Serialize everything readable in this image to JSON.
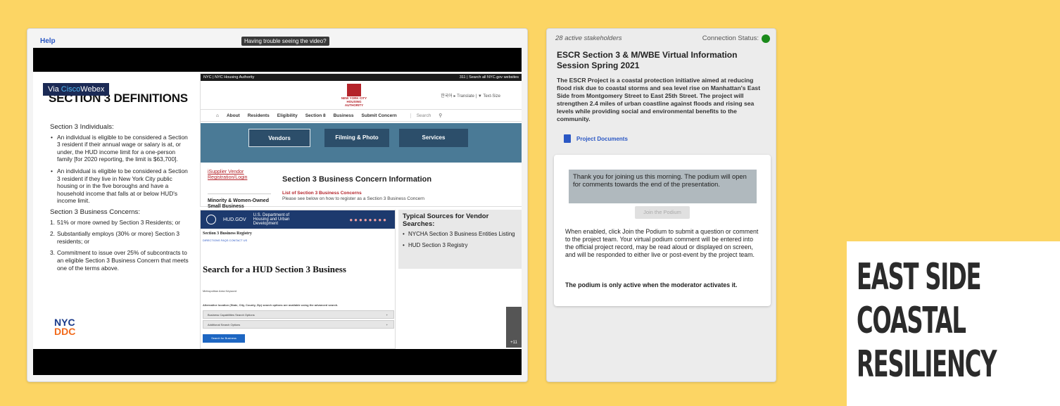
{
  "left_panel": {
    "help": "Help",
    "trouble": "Having trouble seeing the video?"
  },
  "webex": {
    "prefix": "Via ",
    "brand": "Cisco",
    "suffix": "Webex"
  },
  "slide": {
    "title": "SECTION 3 DEFINITIONS",
    "individuals_heading": "Section 3 Individuals:",
    "individuals": [
      "An individual is eligible to be considered a Section 3 resident if their annual wage or salary is at, or under, the HUD income limit for a one-person family [for 2020 reporting, the limit is $63,700].",
      "An individual is eligible to be considered a Section 3 resident if they live in New York City public housing or in the five boroughs and have a household income that falls at or below HUD's income limit."
    ],
    "concerns_heading": "Section 3 Business Concerns:",
    "concerns": [
      {
        "num": "1.",
        "text": "51% or more owned by Section 3 Residents; or"
      },
      {
        "num": "2.",
        "text": "Substantially employs (30% or more) Section 3 residents; or"
      },
      {
        "num": "3.",
        "text": "Commitment to issue over 25% of subcontracts to an eligible Section 3 Business Concern that meets one of the terms above."
      }
    ],
    "logo": {
      "line1": "NYC",
      "line2": "DDC"
    }
  },
  "nycha": {
    "bar_left": "NYC | NYC Housing Authority",
    "bar_right": "311 | Search all NYC.gov websites",
    "logo_text": "NEW YORK CITY HOUSING AUTHORITY",
    "lang": "한국어 ▸ Translate | ▼   Text-Size",
    "nav": [
      "About",
      "Residents",
      "Eligibility",
      "Section 8",
      "Business",
      "Submit Concern"
    ],
    "search": "Search",
    "buttons": [
      "Vendors",
      "Filming & Photo",
      "Services"
    ],
    "isupplier": "iSupplier Vendor Registration/Login",
    "mwob": "Minority & Women-Owned Small Business",
    "bci_title": "Section 3 Business Concern Information",
    "list_link": "List of Section 3 Business Concerns",
    "please": "Please see below on how to register as a Section 3 Business Concern"
  },
  "hud": {
    "gov": "HUD.GOV",
    "dept": "U.S. Department of Housing and Urban Development",
    "registry": "Section 3 Business Registry",
    "links": "DIRECTIONS   FAQS   CONTACT US",
    "search_title": "Search for a HUD Section 3 Business",
    "metro": "Metropolitan Area                                   Keyword",
    "alt": "Alternative location (State, City, County, Zip) search options are available using the advanced search.",
    "row1": "Business Capabilities Search Options",
    "row2": "Additional Search Options",
    "plus": "+",
    "button": "Search for Business"
  },
  "typical": {
    "heading": "Typical Sources for Vendor Searches:",
    "items": [
      "NYCHA Section 3 Business Entities Listing",
      "HUD Section 3 Registry"
    ]
  },
  "plus_count": "+11",
  "right_panel": {
    "stakeholders": "28 active stakeholders",
    "connection": "Connection Status:",
    "title": "ESCR Section 3 & M/WBE Virtual Information Session Spring 2021",
    "description": "The ESCR Project is a coastal protection initiative aimed at reducing flood risk due to coastal storms and sea level rise on Manhattan's East Side from Montgomery Street to East 25th Street. The project will strengthen 2.4 miles of urban coastline against floods and rising sea levels while providing social and environmental benefits to the community.",
    "documents": "Project Documents",
    "notice": "Thank you for joining us this morning. The podium will open for comments towards the end of the presentation.",
    "join": "Join the Podium",
    "enabled": "When enabled, click Join the Podium to submit a question or comment to the project team. Your virtual podium comment will be entered into the official project record, may be read aloud or displayed on screen, and will be responded to either live or post-event by the project team.",
    "active": "The podium is only active when the moderator activates it.",
    "status_color": "#1a8a1a"
  },
  "brand": [
    "EAST SIDE",
    "COASTAL",
    "RESILIENCY"
  ]
}
